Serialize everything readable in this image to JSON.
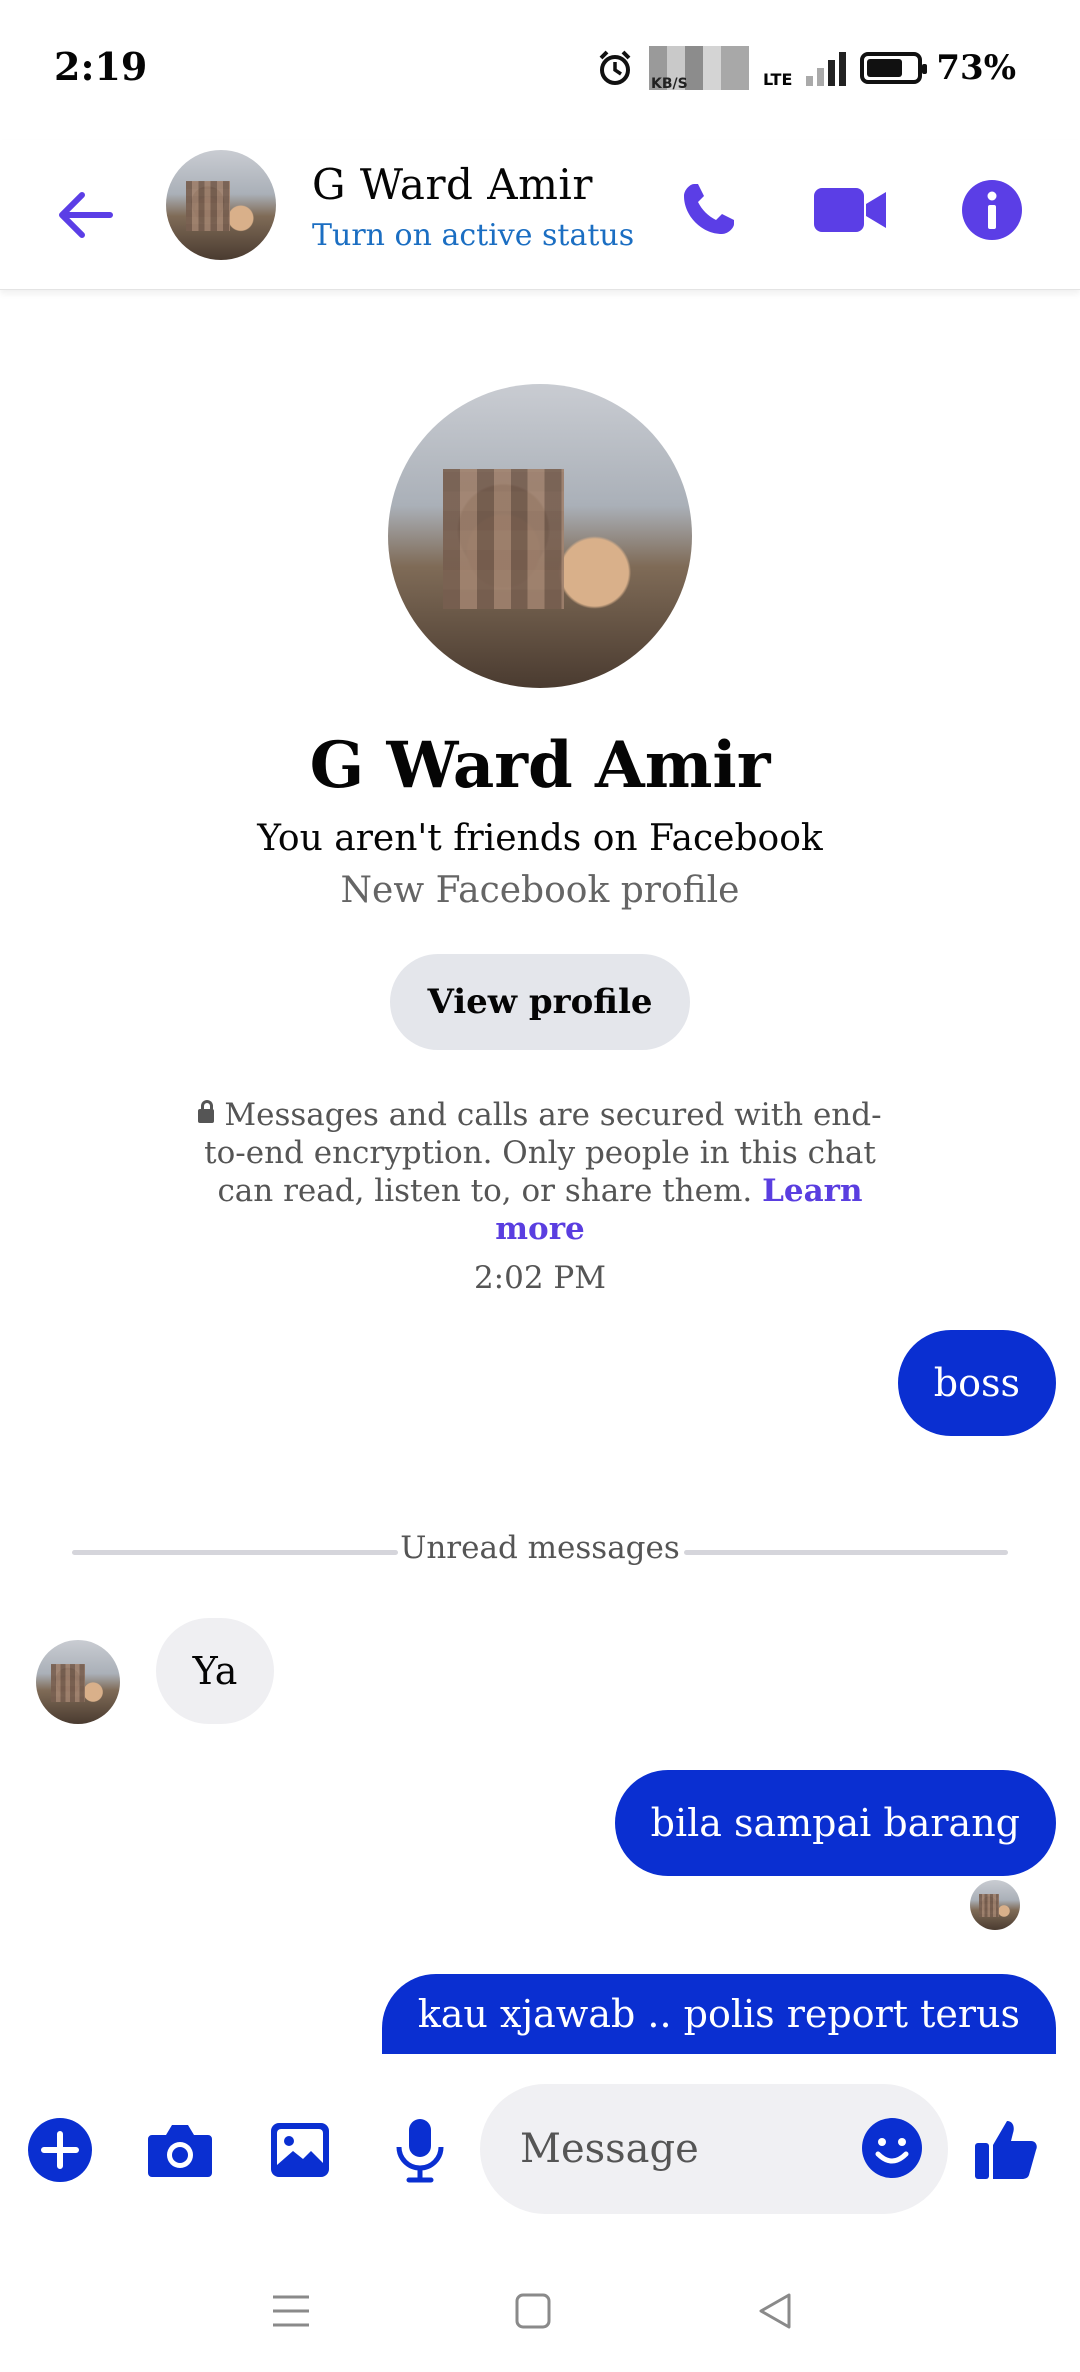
{
  "status_bar": {
    "time": "2:19",
    "net_speed_unit": "KB/S",
    "network": "LTE",
    "battery": "73%",
    "battery_level": 0.73
  },
  "header": {
    "contact_name": "G Ward Amir",
    "status_link": "Turn on active status",
    "accent_color": "#5b3ee6"
  },
  "profile": {
    "name": "G Ward Amir",
    "friend_status": "You aren't friends on Facebook",
    "profile_note": "New Facebook profile",
    "view_profile_label": "View profile"
  },
  "encryption": {
    "text": "Messages and calls are secured with end-to-end encryption. Only people in this chat can read, listen to, or share them.",
    "link": "Learn more"
  },
  "conversation": {
    "timestamp": "2:02 PM",
    "unread_label": "Unread messages",
    "messages": [
      {
        "from": "me",
        "text": "boss"
      },
      {
        "from": "them",
        "text": "Ya"
      },
      {
        "from": "me",
        "text": "bila sampai barang"
      },
      {
        "from": "me",
        "text": "kau xjawab .. polis report terus"
      }
    ]
  },
  "composer": {
    "placeholder": "Message"
  }
}
